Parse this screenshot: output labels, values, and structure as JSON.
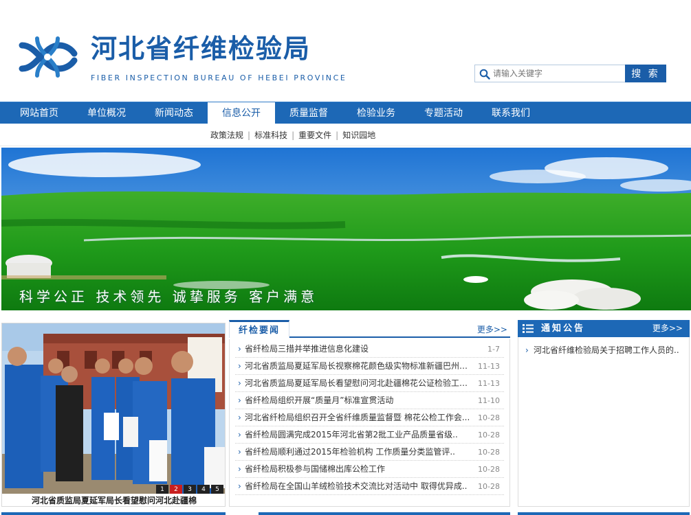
{
  "header": {
    "title": "河北省纤维检验局",
    "subtitle": "FIBER INSPECTION BUREAU OF HEBEI PROVINCE"
  },
  "search": {
    "placeholder": "请输入关键字",
    "button": "搜 索"
  },
  "nav": {
    "items": [
      {
        "label": "网站首页"
      },
      {
        "label": "单位概况"
      },
      {
        "label": "新闻动态"
      },
      {
        "label": "信息公开"
      },
      {
        "label": "质量监督"
      },
      {
        "label": "检验业务"
      },
      {
        "label": "专题活动"
      },
      {
        "label": "联系我们"
      }
    ],
    "active_index": 3
  },
  "subnav": {
    "items": [
      {
        "label": "政策法规"
      },
      {
        "label": "标准科技"
      },
      {
        "label": "重要文件"
      },
      {
        "label": "知识园地"
      }
    ],
    "separator": "|"
  },
  "banner": {
    "slogan": "科学公正 技术领先 诚挚服务 客户满意"
  },
  "photo": {
    "caption": "河北省质监局夏延军局长看望慰问河北赴疆棉",
    "pages": [
      "1",
      "2",
      "3",
      "4",
      "5"
    ],
    "active_page": 1
  },
  "news": {
    "tab": "纤检要闻",
    "more": "更多>>",
    "items": [
      {
        "title": "省纤检局三措并举推进信息化建设",
        "date": "1-7"
      },
      {
        "title": "河北省质监局夏延军局长视察棉花颜色级实物标准新疆巴州采...",
        "date": "11-13"
      },
      {
        "title": "河北省质监局夏延军局长看望慰问河北赴疆棉花公证检验工作...",
        "date": "11-13"
      },
      {
        "title": "省纤检局组织开展“质量月”标准宣贯活动",
        "date": "11-10"
      },
      {
        "title": "河北省纤检局组织召开全省纤维质量监督暨 棉花公检工作会...",
        "date": "10-28"
      },
      {
        "title": "省纤检局圆满完成2015年河北省第2批工业产品质量省级..",
        "date": "10-28"
      },
      {
        "title": "省纤检局顺利通过2015年检验机构 工作质量分类监管评..",
        "date": "10-28"
      },
      {
        "title": "省纤检局积极参与国储棉出库公检工作",
        "date": "10-28"
      },
      {
        "title": "省纤检局在全国山羊绒检验技术交流比对活动中 取得优异成..",
        "date": "10-28"
      }
    ]
  },
  "notice": {
    "title": "通知公告",
    "more": "更多>>",
    "items": [
      {
        "text": "河北省纤维检验局关于招聘工作人员的.."
      }
    ]
  },
  "colors": {
    "brand": "#1a5da8",
    "nav": "#1d68b6",
    "active_pager": "#c81e1e"
  }
}
